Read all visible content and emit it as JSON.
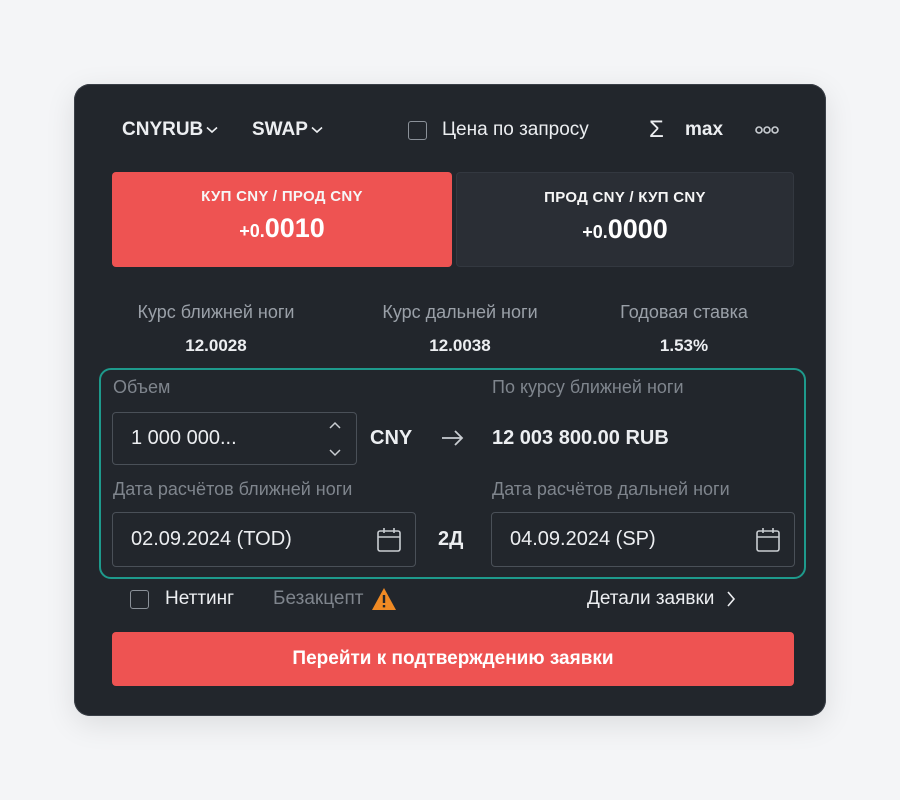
{
  "header": {
    "pair": "CNYRUB",
    "type": "SWAP",
    "rfq_label": "Цена по запросу",
    "max_label": "max"
  },
  "sides": {
    "buy": {
      "label": "КУП CNY / ПРОД CNY",
      "price_prefix": "+0.",
      "price_main": "0010"
    },
    "sell": {
      "label": "ПРОД CNY / КУП CNY",
      "price_prefix": "+0.",
      "price_main": "0000"
    }
  },
  "rates": {
    "near": {
      "label": "Курс ближней ноги",
      "value": "12.0028"
    },
    "far": {
      "label": "Курс дальней ноги",
      "value": "12.0038"
    },
    "annual": {
      "label": "Годовая ставка",
      "value": "1.53%"
    }
  },
  "volume": {
    "label": "Объем",
    "value": "1 000 000...",
    "currency": "CNY",
    "result_label": "По курсу ближней ноги",
    "result_value": "12 003 800.00 RUB"
  },
  "dates": {
    "near_label": "Дата расчётов ближней ноги",
    "near_value": "02.09.2024 (TOD)",
    "tenor": "2Д",
    "far_label": "Дата расчётов дальней ноги",
    "far_value": "04.09.2024 (SP)"
  },
  "options": {
    "netting_label": "Неттинг",
    "no_accept_label": "Безакцепт",
    "details_label": "Детали заявки"
  },
  "submit_label": "Перейти к подтверждению заявки",
  "colors": {
    "panel_bg": "#22262c",
    "buy_accent": "#ee5352",
    "highlight_frame": "#1e9a8c",
    "warning": "#f08a24"
  }
}
